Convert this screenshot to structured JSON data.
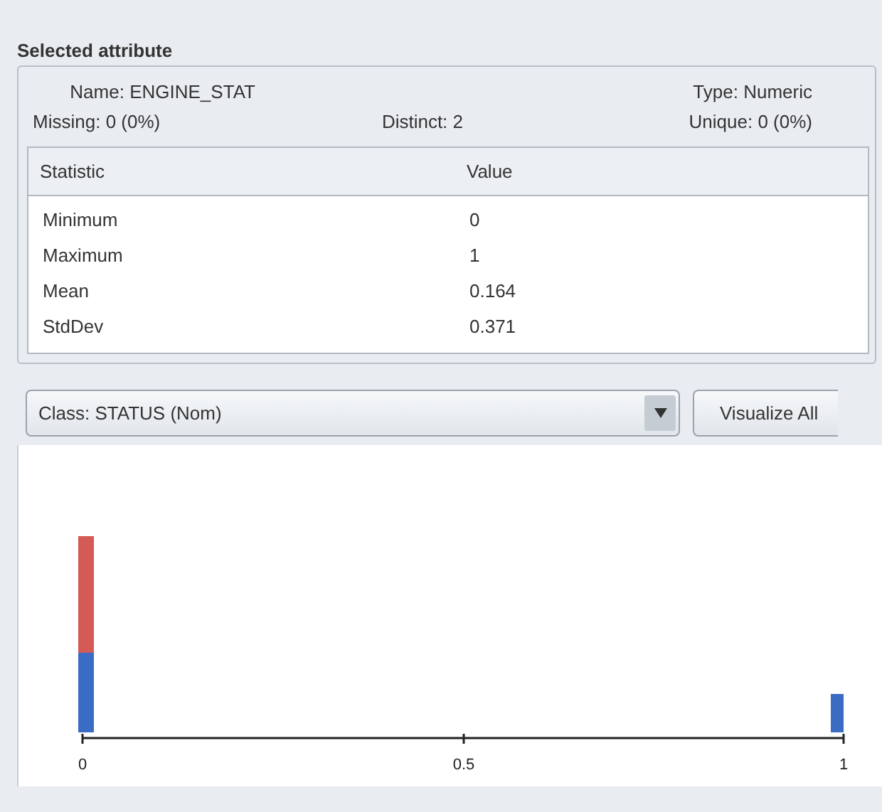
{
  "panel": {
    "title": "Selected attribute",
    "info": [
      {
        "label": "Name:",
        "value": "ENGINE_STAT"
      },
      {
        "label": "Type:",
        "value": "Numeric"
      },
      {
        "label": "Missing:",
        "value": "0 (0%)"
      },
      {
        "label": "Distinct:",
        "value": "2"
      },
      {
        "label": "Unique:",
        "value": "0 (0%)"
      }
    ],
    "table": {
      "columns": [
        "Statistic",
        "Value"
      ],
      "rows": [
        [
          "Minimum",
          "0"
        ],
        [
          "Maximum",
          "1"
        ],
        [
          "Mean",
          "0.164"
        ],
        [
          "StdDev",
          "0.371"
        ]
      ]
    }
  },
  "class_select": {
    "value": "Class: STATUS (Nom)"
  },
  "buttons": [
    "Visualize All"
  ],
  "histogram": {
    "axis_labels": [
      "0",
      "0.5",
      "1"
    ]
  }
}
